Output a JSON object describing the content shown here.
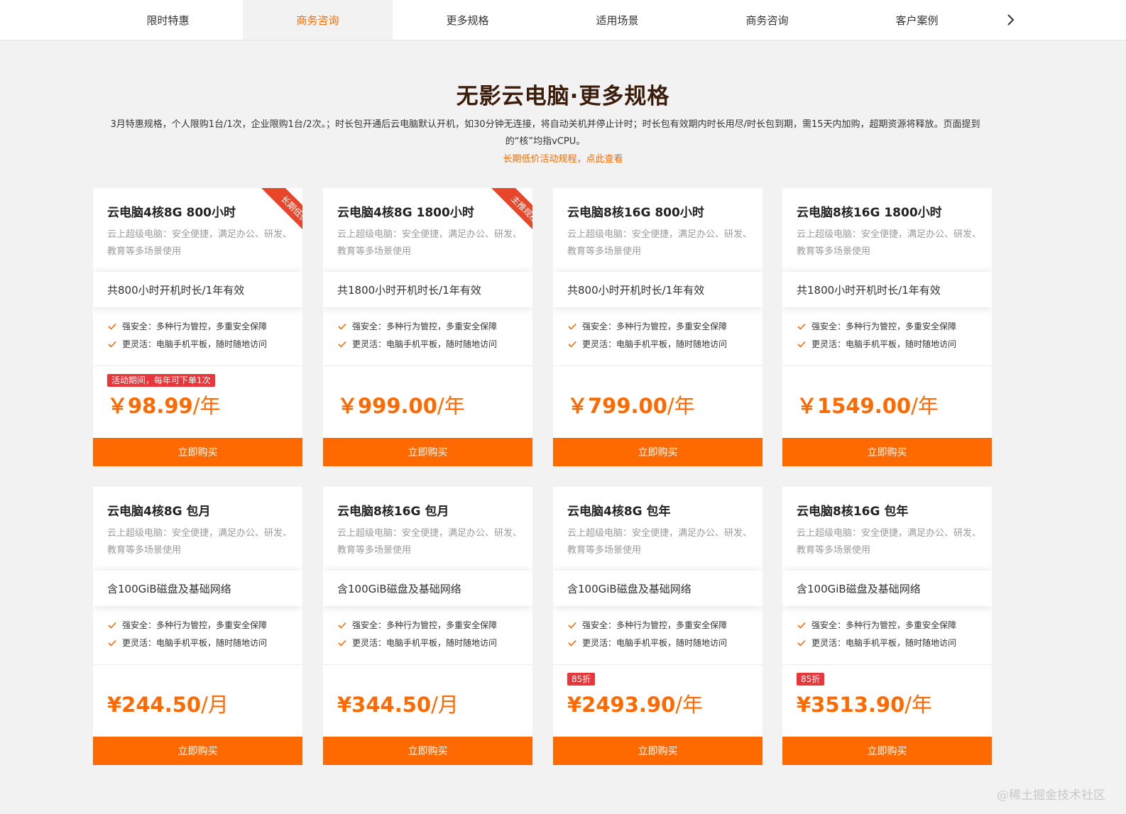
{
  "tabs": [
    {
      "label": "限时特惠",
      "active": false
    },
    {
      "label": "商务咨询",
      "active": true
    },
    {
      "label": "更多规格",
      "active": false
    },
    {
      "label": "适用场景",
      "active": false
    },
    {
      "label": "商务咨询",
      "active": false
    },
    {
      "label": "客户案例",
      "active": false
    }
  ],
  "header": {
    "title": "无影云电脑·更多规格",
    "description": "3月特惠规格，个人限购1台/1次，企业限购1台/2次。；时长包开通后云电脑默认开机，如30分钟无连接，将自动关机并停止计时；时长包有效期内时长用尽/时长包到期，需15天内加购，超期资源将释放。页面提到的“核”均指vCPU。",
    "rules_link": "长期低价活动规程，点此查看"
  },
  "cards": [
    {
      "title": "云电脑4核8G 800小时",
      "desc": "云上超级电脑：安全便捷，满足办公、研发、教育等多场景使用",
      "band": "共800小时开机时长/1年有效",
      "features": [
        "强安全：多种行为管控，多重安全保障",
        "更灵活：电脑手机平板，随时随地访问"
      ],
      "ribbon": "长期低价",
      "badge": "活动期间，每年可下单1次",
      "price": "￥98.99",
      "unit": "/年",
      "button": "立即购买"
    },
    {
      "title": "云电脑4核8G 1800小时",
      "desc": "云上超级电脑：安全便捷，满足办公、研发、教育等多场景使用",
      "band": "共1800小时开机时长/1年有效",
      "features": [
        "强安全：多种行为管控，多重安全保障",
        "更灵活：电脑手机平板，随时随地访问"
      ],
      "ribbon": "主推规格",
      "badge": "",
      "price": "￥999.00",
      "unit": "/年",
      "button": "立即购买"
    },
    {
      "title": "云电脑8核16G 800小时",
      "desc": "云上超级电脑：安全便捷，满足办公、研发、教育等多场景使用",
      "band": "共800小时开机时长/1年有效",
      "features": [
        "强安全：多种行为管控，多重安全保障",
        "更灵活：电脑手机平板，随时随地访问"
      ],
      "ribbon": "",
      "badge": "",
      "price": "￥799.00",
      "unit": "/年",
      "button": "立即购买"
    },
    {
      "title": "云电脑8核16G 1800小时",
      "desc": "云上超级电脑：安全便捷，满足办公、研发、教育等多场景使用",
      "band": "共1800小时开机时长/1年有效",
      "features": [
        "强安全：多种行为管控，多重安全保障",
        "更灵活：电脑手机平板，随时随地访问"
      ],
      "ribbon": "",
      "badge": "",
      "price": "￥1549.00",
      "unit": "/年",
      "button": "立即购买"
    },
    {
      "title": "云电脑4核8G 包月",
      "desc": "云上超级电脑：安全便捷，满足办公、研发、教育等多场景使用",
      "band": "含100GiB磁盘及基础网络",
      "features": [
        "强安全：多种行为管控，多重安全保障",
        "更灵活：电脑手机平板，随时随地访问"
      ],
      "ribbon": "",
      "badge": "",
      "price": "¥244.50",
      "unit": "/月",
      "button": "立即购买"
    },
    {
      "title": "云电脑8核16G 包月",
      "desc": "云上超级电脑：安全便捷，满足办公、研发、教育等多场景使用",
      "band": "含100GiB磁盘及基础网络",
      "features": [
        "强安全：多种行为管控，多重安全保障",
        "更灵活：电脑手机平板，随时随地访问"
      ],
      "ribbon": "",
      "badge": "",
      "price": "¥344.50",
      "unit": "/月",
      "button": "立即购买"
    },
    {
      "title": "云电脑4核8G 包年",
      "desc": "云上超级电脑：安全便捷，满足办公、研发、教育等多场景使用",
      "band": "含100GiB磁盘及基础网络",
      "features": [
        "强安全：多种行为管控，多重安全保障",
        "更灵活：电脑手机平板，随时随地访问"
      ],
      "ribbon": "",
      "badge": "85折",
      "price": "¥2493.90",
      "unit": "/年",
      "button": "立即购买"
    },
    {
      "title": "云电脑8核16G 包年",
      "desc": "云上超级电脑：安全便捷，满足办公、研发、教育等多场景使用",
      "band": "含100GiB磁盘及基础网络",
      "features": [
        "强安全：多种行为管控，多重安全保障",
        "更灵活：电脑手机平板，随时随地访问"
      ],
      "ribbon": "",
      "badge": "85折",
      "price": "¥3513.90",
      "unit": "/年",
      "button": "立即购买"
    }
  ],
  "colors": {
    "accent": "#ff6a00",
    "badge": "#e8363b",
    "ribbon": "#e8462a",
    "title": "#3a1d0a"
  },
  "icons": {
    "next": "chevron-right-icon",
    "check": "check-icon"
  },
  "watermark": "@稀土掘金技术社区"
}
